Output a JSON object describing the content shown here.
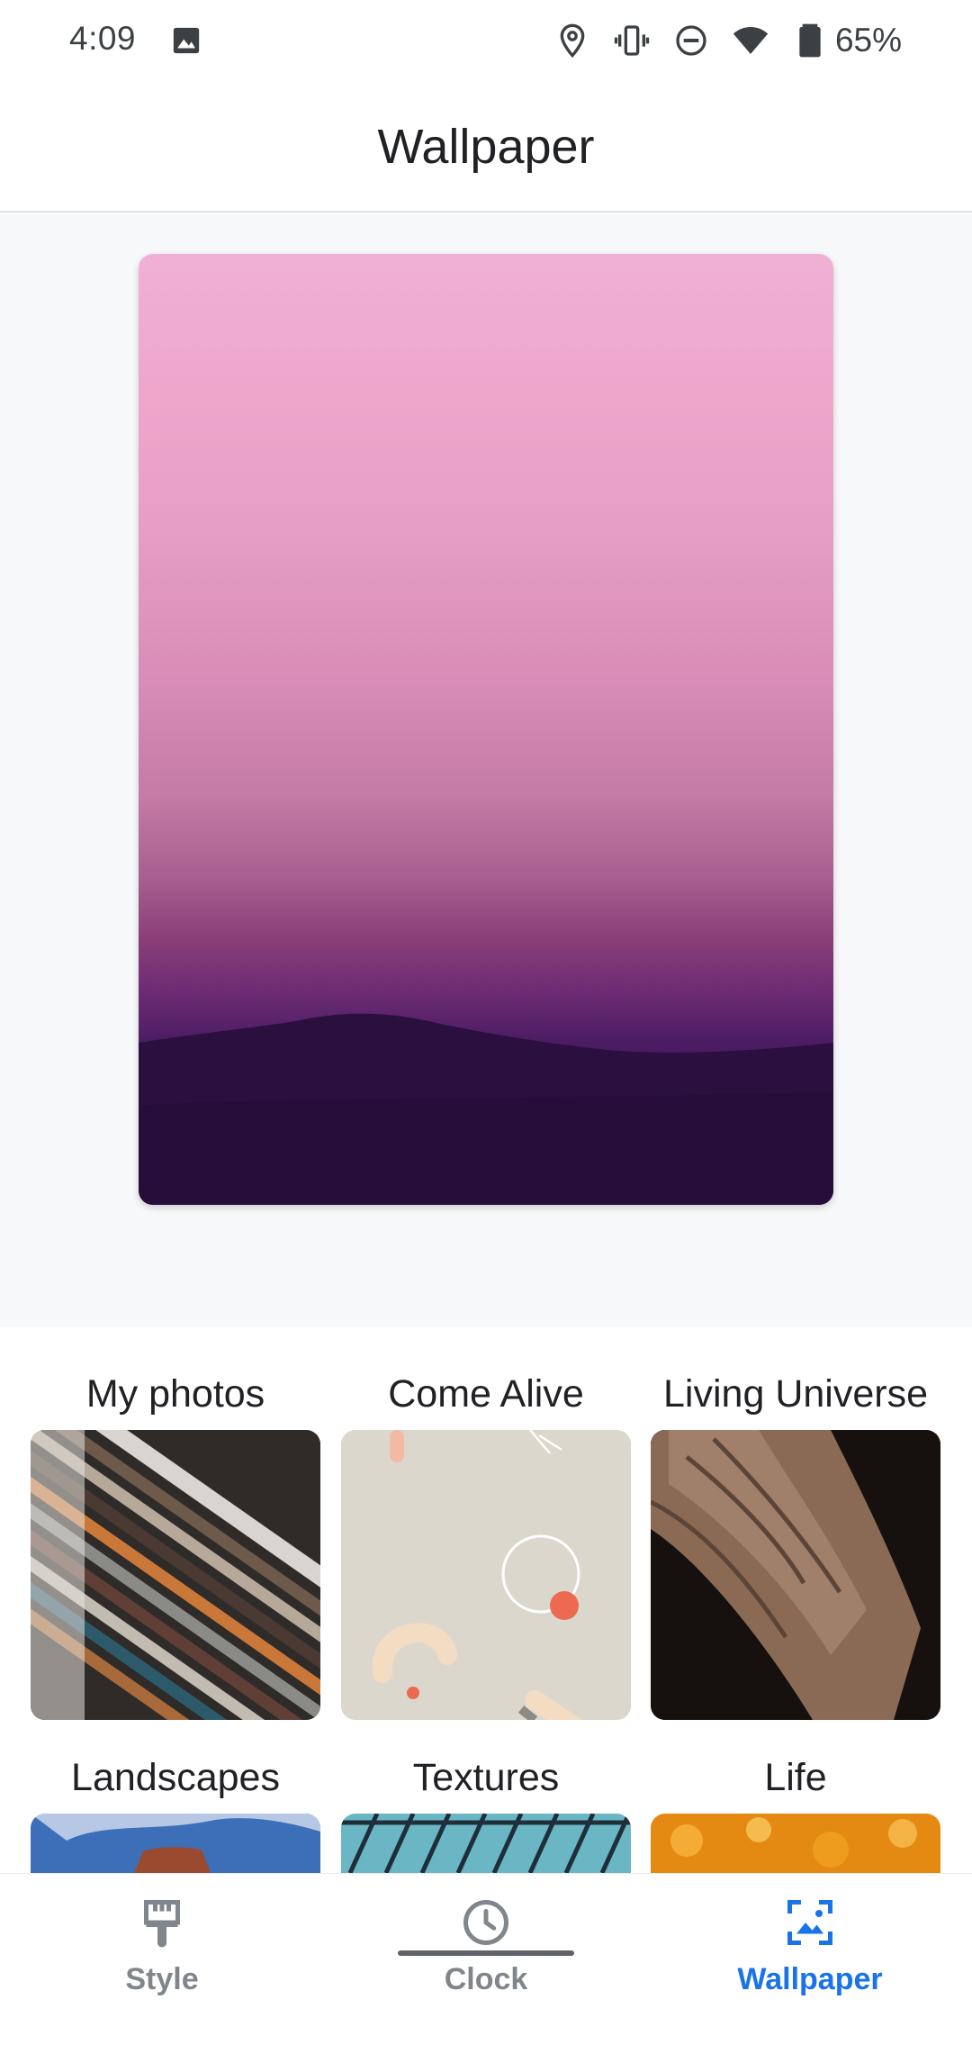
{
  "status_bar": {
    "time": "4:09",
    "battery": "65%"
  },
  "app_bar": {
    "title": "Wallpaper"
  },
  "categories": [
    {
      "label": "My photos"
    },
    {
      "label": "Come Alive"
    },
    {
      "label": "Living Universe"
    },
    {
      "label": "Landscapes"
    },
    {
      "label": "Textures"
    },
    {
      "label": "Life"
    }
  ],
  "bottom_nav": {
    "items": [
      {
        "label": "Style",
        "icon": "paintbrush-icon"
      },
      {
        "label": "Clock",
        "icon": "clock-icon"
      },
      {
        "label": "Wallpaper",
        "icon": "wallpaper-icon"
      }
    ],
    "active": "Wallpaper"
  },
  "colors": {
    "accent": "#1a73e8",
    "inactive": "#80868b"
  }
}
